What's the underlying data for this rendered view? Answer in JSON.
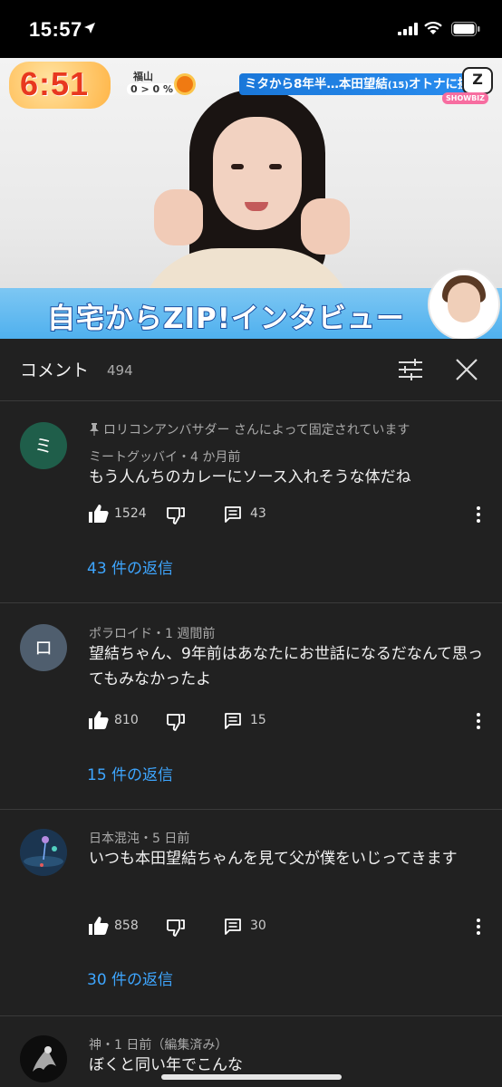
{
  "status": {
    "time": "15:57"
  },
  "video": {
    "clock": "6:51",
    "weather_city": "福山",
    "weather_temp": "0 > 0 %",
    "headline": "ミタから8年半…本田望結",
    "headline_age": "(15)",
    "headline_tail": "オトナに挑戦",
    "showbiz": "SHOWBIZ",
    "zip_logo": "Z",
    "banner_text": "自宅からZIP!インタビュー"
  },
  "panel": {
    "title": "コメント",
    "count": "494"
  },
  "comments": [
    {
      "avatar_letter": "ミ",
      "avatar_color": "#1f5e4a",
      "pinned": "ロリコンアンバサダー さんによって固定されています",
      "meta": "ミートグッバイ・4 か月前",
      "text": "もう人んちのカレーにソース入れそうな体だね",
      "likes": "1524",
      "replies": "43",
      "replies_link": "43 件の返信"
    },
    {
      "avatar_letter": "ロ",
      "avatar_color": "#4f5e6e",
      "meta": "ポラロイド・1 週間前",
      "text": "望結ちゃん、9年前はあなたにお世話になるだなんて思ってもみなかったよ",
      "likes": "810",
      "replies": "15",
      "replies_link": "15 件の返信"
    },
    {
      "avatar_letter": "",
      "avatar_color": "#1e3a52",
      "meta": "日本混沌・5 日前",
      "text": "いつも本田望結ちゃんを見て父が僕をいじってきます",
      "likes": "858",
      "replies": "30",
      "replies_link": "30 件の返信"
    },
    {
      "avatar_letter": "",
      "avatar_color": "#111111",
      "meta": "神・1 日前（編集済み）",
      "text": "ぼくと同い年でこんな"
    }
  ]
}
